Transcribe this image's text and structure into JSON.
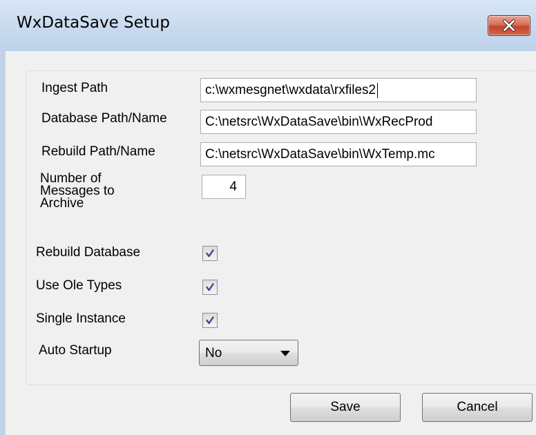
{
  "window": {
    "title": "WxDataSave Setup"
  },
  "form": {
    "ingest_path": {
      "label": "Ingest Path",
      "value": "c:\\wxmesgnet\\wxdata\\rxfiles2"
    },
    "database_path": {
      "label": "Database Path/Name",
      "value": "C:\\netsrc\\WxDataSave\\bin\\WxRecProd"
    },
    "rebuild_path": {
      "label": "Rebuild Path/Name",
      "value": "C:\\netsrc\\WxDataSave\\bin\\WxTemp.mc"
    },
    "archive_count": {
      "label": "Number of Messages  to Archive",
      "value": "4"
    },
    "rebuild_database": {
      "label": "Rebuild Database",
      "checked": true
    },
    "use_ole_types": {
      "label": "Use Ole Types",
      "checked": true
    },
    "single_instance": {
      "label": "Single Instance",
      "checked": true
    },
    "auto_startup": {
      "label": "Auto Startup",
      "value": "No"
    }
  },
  "buttons": {
    "save_label": "Save",
    "cancel_label": "Cancel"
  },
  "icons": {
    "close": "close-icon",
    "check": "check-icon",
    "dropdown": "chevron-down-icon"
  },
  "colors": {
    "titlebar": "#c8daef",
    "close_button": "#c1452c",
    "client_background": "#f0f0f0",
    "check_mark": "#3c4a8a"
  }
}
